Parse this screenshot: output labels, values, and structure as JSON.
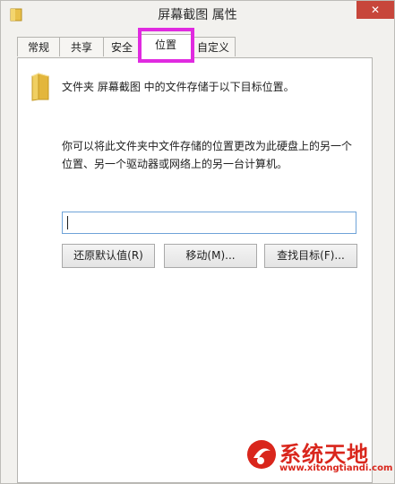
{
  "window": {
    "title": "屏幕截图 属性",
    "close_glyph": "✕"
  },
  "tabs": [
    {
      "label": "常规"
    },
    {
      "label": "共享"
    },
    {
      "label": "安全"
    },
    {
      "label": "位置",
      "active": true
    },
    {
      "label": "自定义"
    }
  ],
  "panel": {
    "intro": "文件夹 屏幕截图 中的文件存储于以下目标位置。",
    "description": "你可以将此文件夹中文件存储的位置更改为此硬盘上的另一个位置、另一个驱动器或网络上的另一台计算机。",
    "path_value": "",
    "buttons": {
      "restore_default": "还原默认值(R)",
      "move": "移动(M)...",
      "find_target": "查找目标(F)..."
    }
  },
  "watermark": {
    "title": "系统天地",
    "url": "www.xitongtiandi.com"
  },
  "icons": {
    "title": "folder-icon",
    "close": "close-icon",
    "panel": "folder-icon",
    "watermark": "logo-icon"
  },
  "colors": {
    "highlight": "#e02ae0",
    "close_button": "#c7463b",
    "input_border": "#6fa3d8",
    "watermark": "#d9261c"
  }
}
